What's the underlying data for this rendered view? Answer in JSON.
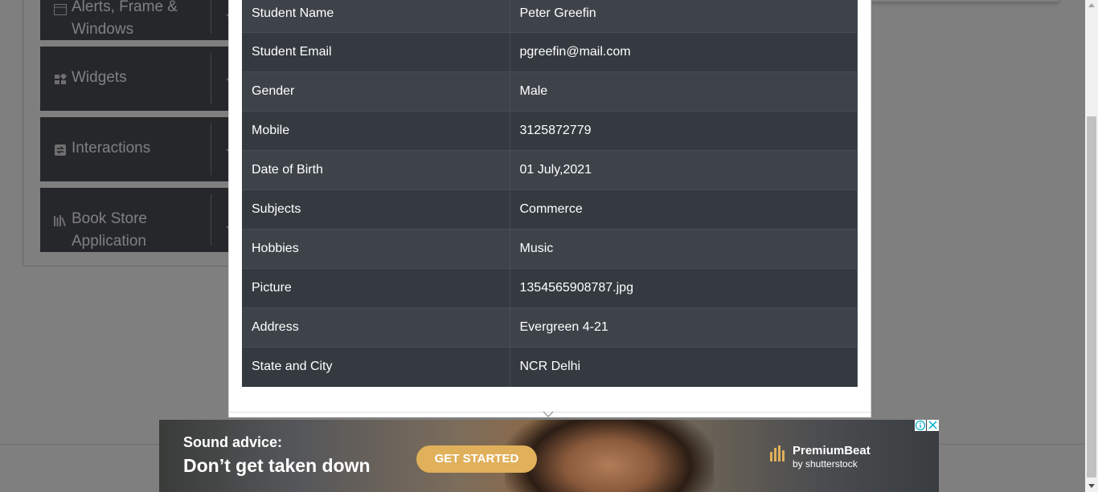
{
  "sidebar": {
    "groups": [
      {
        "label_line1": "Alerts, Frame &",
        "label_line2": "Windows",
        "icon": "window-icon"
      },
      {
        "label_line1": "Widgets",
        "label_line2": "",
        "icon": "widgets-icon"
      },
      {
        "label_line1": "Interactions",
        "label_line2": "",
        "icon": "interactions-icon"
      },
      {
        "label_line1": "Book Store",
        "label_line2": "Application",
        "icon": "books-icon"
      }
    ]
  },
  "results": {
    "rows": [
      {
        "label": "Student Name",
        "value": "Peter Greefin"
      },
      {
        "label": "Student Email",
        "value": "pgreefin@mail.com"
      },
      {
        "label": "Gender",
        "value": "Male"
      },
      {
        "label": "Mobile",
        "value": "3125872779"
      },
      {
        "label": "Date of Birth",
        "value": "01 July,2021"
      },
      {
        "label": "Subjects",
        "value": "Commerce"
      },
      {
        "label": "Hobbies",
        "value": "Music"
      },
      {
        "label": "Picture",
        "value": "1354565908787.jpg"
      },
      {
        "label": "Address",
        "value": "Evergreen 4-21"
      },
      {
        "label": "State and City",
        "value": "NCR Delhi"
      }
    ]
  },
  "ad": {
    "headline1": "Sound advice:",
    "headline2": "Don’t get taken down",
    "cta": "GET STARTED",
    "brand_name": "PremiumBeat",
    "brand_by": "by shutterstock",
    "info_icon": "info-icon",
    "close_icon": "close-icon"
  },
  "colors": {
    "table_dark": "#343a40",
    "table_stripe": "#3e434a",
    "sidebar_group": "#4a4f55",
    "cta": "#e0b05a"
  }
}
